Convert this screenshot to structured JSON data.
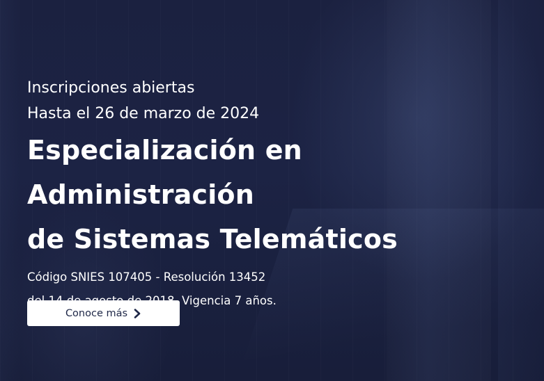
{
  "hero": {
    "kicker_line1": "Inscripciones abiertas",
    "kicker_line2": "Hasta el 26 de marzo de 2024",
    "title_line1": "Especialización en Administración",
    "title_line2": "de Sistemas Telemáticos",
    "meta_line1": "Código SNIES 107405 - Resolución 13452",
    "meta_line2": "del 14 de agosto de 2018, Vigencia 7 años.",
    "cta_label": "Conoce más",
    "cta_icon": "chevron-right-icon"
  },
  "colors": {
    "background": "#1b2140",
    "text": "#ffffff",
    "button_bg": "#ffffff",
    "button_text": "#1e2747"
  }
}
